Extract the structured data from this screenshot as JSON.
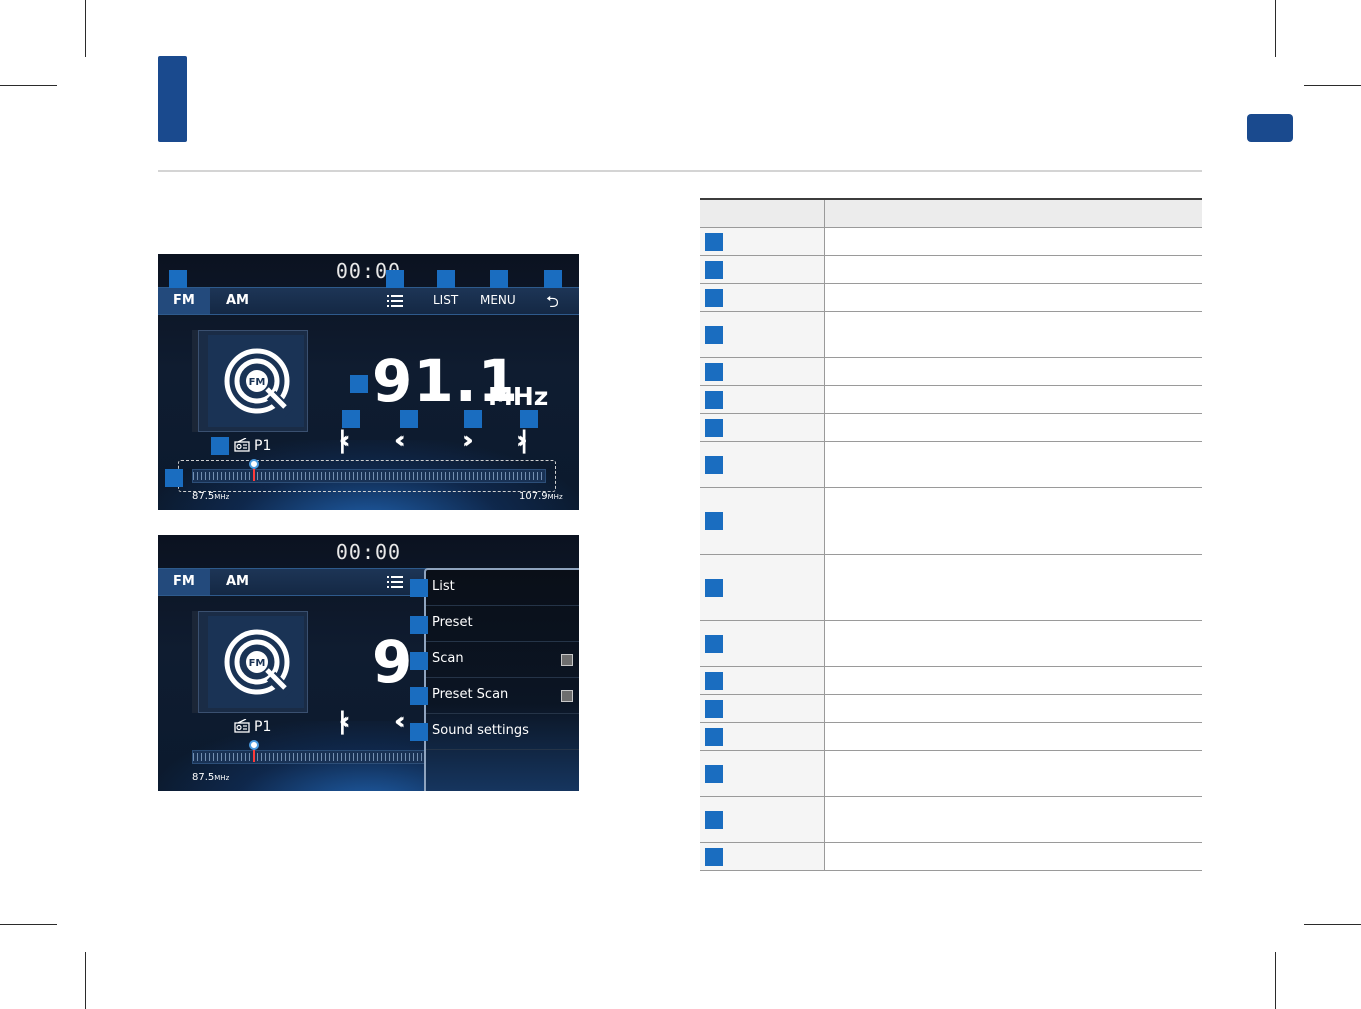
{
  "screen_a": {
    "clock": "00:00",
    "tabs": [
      "FM",
      "AM"
    ],
    "buttons": {
      "list": "LIST",
      "menu": "MENU"
    },
    "art_badge": "FM",
    "preset": "P1",
    "frequency": "91.1",
    "frequency_unit": "MHz",
    "scale_min": "87.5",
    "scale_max": "107.9",
    "scale_unit": "MHz",
    "tuned_fraction": 0.177
  },
  "screen_b": {
    "clock": "00:00",
    "tabs": [
      "FM",
      "AM"
    ],
    "art_badge": "FM",
    "preset": "P1",
    "frequency_partial": "9",
    "scale_min": "87.5",
    "scale_unit": "MHz",
    "menu": [
      {
        "label": "List",
        "has_checkbox": false
      },
      {
        "label": "Preset",
        "has_checkbox": false
      },
      {
        "label": "Scan",
        "has_checkbox": true
      },
      {
        "label": "Preset Scan",
        "has_checkbox": true
      },
      {
        "label": "Sound settings",
        "has_checkbox": false
      }
    ]
  },
  "icons": {
    "list": "list-icon",
    "back": "back-icon",
    "radio": "radio-icon",
    "skip_back": "skip-back-icon",
    "seek_back": "seek-back-icon",
    "seek_forward": "seek-forward-icon",
    "skip_forward": "skip-forward-icon"
  },
  "colors": {
    "brand_blue": "#1a4a8e",
    "marker_blue": "#1a6dc0",
    "screen_bg": "#0f1c30"
  },
  "table": {
    "row_count": 17
  }
}
